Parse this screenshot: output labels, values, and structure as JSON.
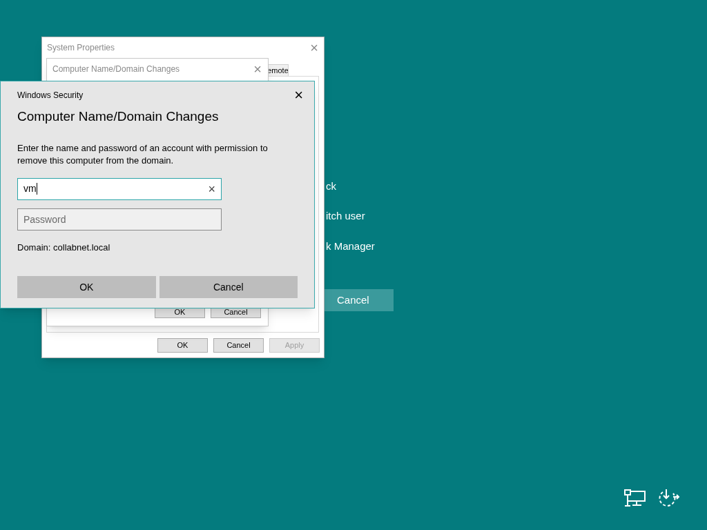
{
  "lock_menu": {
    "items": [
      {
        "label": "ck"
      },
      {
        "label": "itch user"
      },
      {
        "label": "k Manager"
      }
    ],
    "cancel_button": "Cancel"
  },
  "system_properties": {
    "title": "System Properties",
    "close": "×",
    "tab": "emote",
    "buttons": [
      {
        "label": "OK",
        "disabled": false
      },
      {
        "label": "Cancel",
        "disabled": false
      },
      {
        "label": "Apply",
        "disabled": true
      }
    ]
  },
  "name_changes": {
    "title": "Computer Name/Domain Changes",
    "close": "×",
    "buttons": [
      {
        "label": "OK"
      },
      {
        "label": "Cancel"
      }
    ]
  },
  "security_dialog": {
    "title": "Windows Security",
    "close": "×",
    "heading": "Computer Name/Domain Changes",
    "message": "Enter the name and password of an account with permission to remove this computer from the domain.",
    "username": {
      "value": "vm",
      "focused": true,
      "clear": "×"
    },
    "password": {
      "placeholder": "Password",
      "focused": false
    },
    "domain": "Domain: collabnet.local",
    "buttons": [
      {
        "label": "OK"
      },
      {
        "label": "Cancel"
      }
    ]
  }
}
